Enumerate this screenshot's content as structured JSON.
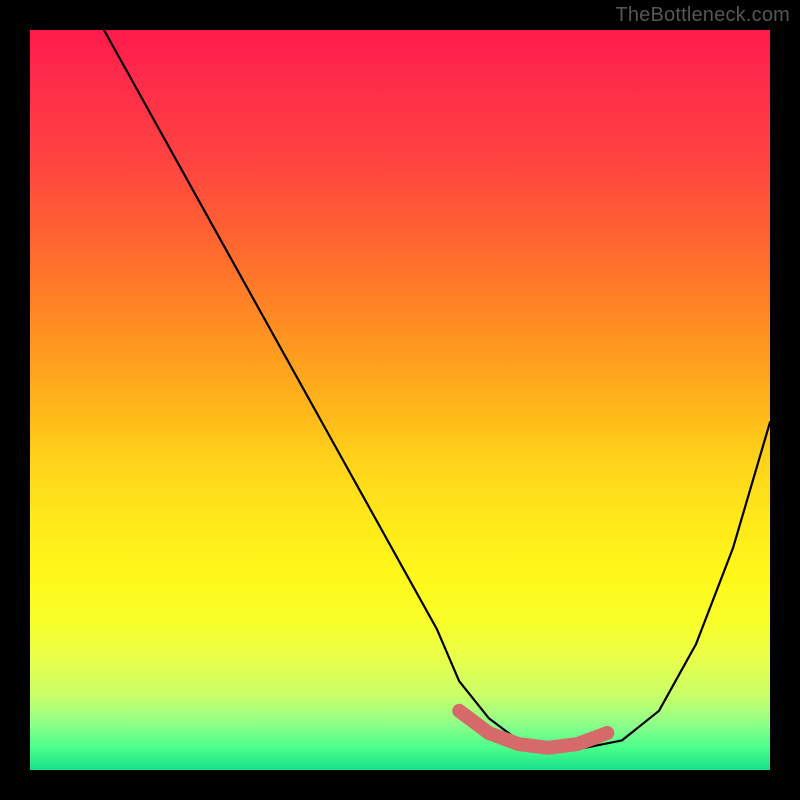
{
  "watermark": "TheBottleneck.com",
  "chart_data": {
    "type": "line",
    "title": "",
    "xlabel": "",
    "ylabel": "",
    "xlim": [
      0,
      100
    ],
    "ylim": [
      0,
      100
    ],
    "grid": false,
    "legend": false,
    "annotations": [],
    "series": [
      {
        "name": "bottleneck-curve",
        "color": "#000000",
        "x": [
          10,
          15,
          20,
          25,
          30,
          35,
          40,
          45,
          50,
          55,
          58,
          62,
          66,
          70,
          75,
          80,
          85,
          90,
          95,
          100
        ],
        "y": [
          100,
          91,
          82,
          73,
          64,
          55,
          46,
          37,
          28,
          19,
          12,
          7,
          4,
          3,
          3,
          4,
          8,
          17,
          30,
          47
        ]
      },
      {
        "name": "optimum-marker-band",
        "color": "#d66a6a",
        "x": [
          58,
          62,
          66,
          70,
          74,
          78
        ],
        "y": [
          8,
          5,
          3.5,
          3,
          3.5,
          5
        ]
      }
    ],
    "background_gradient": {
      "orientation": "vertical",
      "stops": [
        {
          "pos": 0.0,
          "color": "#ff1a4b"
        },
        {
          "pos": 0.5,
          "color": "#ffd21a"
        },
        {
          "pos": 0.8,
          "color": "#f8ff2a"
        },
        {
          "pos": 1.0,
          "color": "#18e08a"
        }
      ]
    }
  }
}
